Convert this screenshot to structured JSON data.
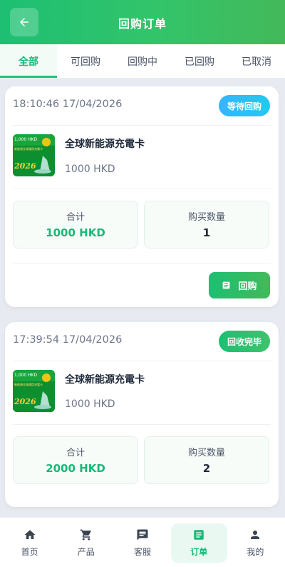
{
  "header": {
    "title": "回购订单",
    "back_icon": "arrow-left-icon"
  },
  "tabs": [
    {
      "label": "全部",
      "active": true
    },
    {
      "label": "可回购",
      "active": false
    },
    {
      "label": "回购中",
      "active": false
    },
    {
      "label": "已回购",
      "active": false
    },
    {
      "label": "已取消",
      "active": false
    }
  ],
  "orders": [
    {
      "time": "18:10:46 17/04/2026",
      "status": "等待回购",
      "product_name": "全球新能源充電卡",
      "product_price": "1000 HKD",
      "total_label": "合计",
      "total_value": "1000 HKD",
      "qty_label": "购买数量",
      "qty_value": "1",
      "action_label": "回购",
      "image_text": {
        "top": "1,000 HKD",
        "sub": "新能源全球通用充電卡",
        "year": "2026"
      }
    },
    {
      "time": "17:39:54 17/04/2026",
      "status": "回收完毕",
      "product_name": "全球新能源充電卡",
      "product_price": "1000 HKD",
      "total_label": "合计",
      "total_value": "2000 HKD",
      "qty_label": "购买数量",
      "qty_value": "2",
      "image_text": {
        "top": "1,000 HKD",
        "sub": "新能源全球通用充電卡",
        "year": "2026"
      }
    }
  ],
  "bottom_nav": [
    {
      "label": "首页",
      "icon": "home-icon",
      "active": false
    },
    {
      "label": "产品",
      "icon": "cart-icon",
      "active": false
    },
    {
      "label": "客服",
      "icon": "chat-icon",
      "active": false
    },
    {
      "label": "订单",
      "icon": "order-icon",
      "active": true
    },
    {
      "label": "我的",
      "icon": "user-icon",
      "active": false
    }
  ],
  "colors": {
    "accent": "#1dbf73",
    "badge_waiting": "#36b4ff",
    "background": "#e7ebf1"
  }
}
